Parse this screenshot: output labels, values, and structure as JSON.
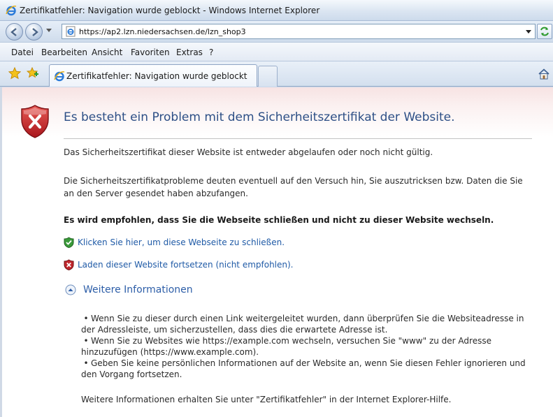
{
  "window": {
    "title": "Zertifikatfehler: Navigation wurde geblockt - Windows Internet Explorer"
  },
  "address_bar": {
    "url": "https://ap2.lzn.niedersachsen.de/lzn_shop3"
  },
  "menu": {
    "items": [
      "Datei",
      "Bearbeiten",
      "Ansicht",
      "Favoriten",
      "Extras",
      "?"
    ]
  },
  "tabs": {
    "active_label": "Zertifikatfehler: Navigation wurde geblockt"
  },
  "page": {
    "heading": "Es besteht ein Problem mit dem Sicherheitszertifikat der Website.",
    "paragraph1": "Das Sicherheitszertifikat dieser Website ist entweder abgelaufen oder noch nicht gültig.",
    "paragraph2": "Die Sicherheitszertifikatprobleme deuten eventuell auf den Versuch hin, Sie auszutricksen bzw. Daten die Sie an den Server gesendet haben abzufangen.",
    "recommendation": "Es wird empfohlen, dass Sie die Webseite schließen und nicht zu dieser Website wechseln.",
    "close_link": "Klicken Sie hier, um diese Webseite zu schließen.",
    "continue_link": "Laden dieser Website fortsetzen (nicht empfohlen).",
    "more_info_heading": "Weitere Informationen",
    "bullets": [
      "Wenn Sie zu dieser durch einen Link weitergeleitet wurden, dann überprüfen Sie die Websiteadresse in der Adressleiste, um sicherzustellen, dass dies die erwartete Adresse ist.",
      "Wenn Sie zu Websites wie https://example.com wechseln, versuchen Sie \"www\" zu der Adresse hinzuzufügen (https://www.example.com).",
      "Geben Sie keine persönlichen Informationen auf der Website an, wenn Sie diesen Fehler ignorieren und den Vorgang fortsetzen."
    ],
    "footer": "Weitere Informationen erhalten Sie unter \"Zertifikatfehler\" in der Internet Explorer-Hilfe."
  },
  "colors": {
    "heading": "#2d4f86",
    "link": "#1f5aa6",
    "error_red": "#c0272d",
    "safe_green": "#3a9a3a"
  },
  "icons": {
    "browser": "ie-icon",
    "error": "shield-error-icon",
    "close_option": "shield-check-icon",
    "continue_option": "shield-x-icon",
    "expand": "expand-up-icon"
  }
}
